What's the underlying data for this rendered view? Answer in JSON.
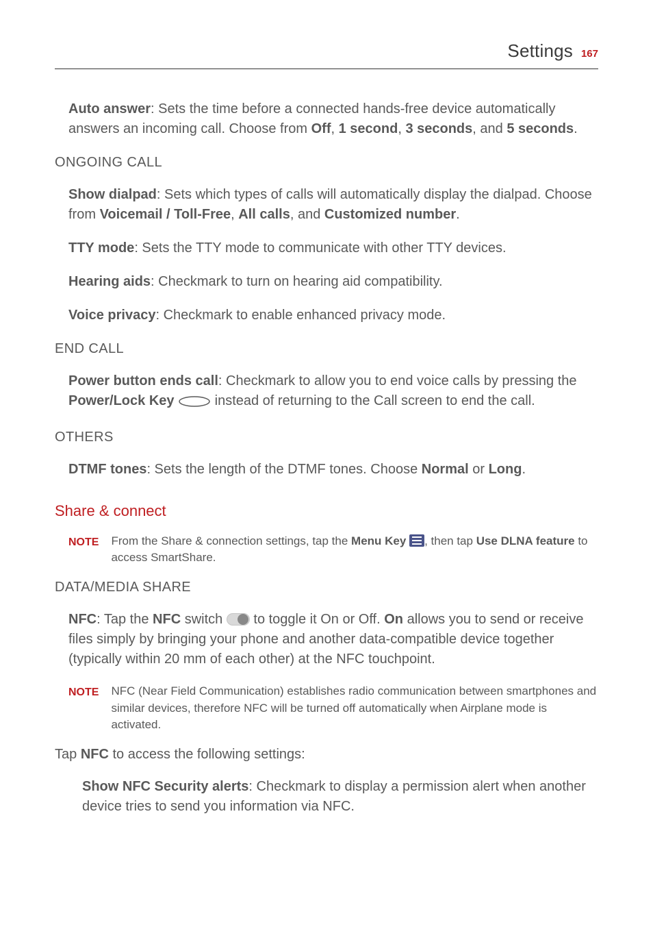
{
  "header": {
    "title": "Settings",
    "page_number": "167"
  },
  "auto_answer": {
    "label": "Auto answer",
    "desc": ": Sets the time before a connected hands-free device automatically answers an incoming call. Choose from ",
    "opts": [
      "Off",
      "1 second",
      "3 seconds",
      "5 seconds"
    ],
    "join1": ", ",
    "join2": ", and ",
    "period": "."
  },
  "ongoing": {
    "heading": "ONGOING CALL",
    "show_dialpad": {
      "label": "Show dialpad",
      "desc": ": Sets which types of calls will automatically display the dialpad. Choose from ",
      "opts": [
        "Voicemail / Toll-Free",
        "All calls",
        "Customized number"
      ],
      "join1": ", ",
      "join2": ", and ",
      "period": "."
    },
    "tty": {
      "label": "TTY mode",
      "desc": ": Sets the TTY mode to communicate with other TTY devices."
    },
    "hearing": {
      "label": "Hearing aids",
      "desc": ": Checkmark to turn on hearing aid compatibility."
    },
    "voice": {
      "label": "Voice privacy",
      "desc": ": Checkmark to enable enhanced privacy mode."
    }
  },
  "endcall": {
    "heading": "END CALL",
    "power": {
      "label": "Power button ends call",
      "desc1": ": Checkmark to allow you to end voice calls by pressing the ",
      "key_label": "Power/Lock Key",
      "desc2": " instead of returning to the Call screen to end the call."
    }
  },
  "others": {
    "heading": "OTHERS",
    "dtmf": {
      "label": "DTMF tones",
      "desc": ": Sets the length of the DTMF tones. Choose ",
      "opts": [
        "Normal",
        "Long"
      ],
      "join": " or ",
      "period": "."
    }
  },
  "share": {
    "heading": "Share & connect",
    "note1": {
      "label": "NOTE",
      "before": "From the Share & connection settings, tap the ",
      "menukey": "Menu Key",
      "mid": ", then tap ",
      "dlna": "Use DLNA feature",
      "after": " to access SmartShare."
    },
    "datamedia_heading": "DATA/MEDIA SHARE",
    "nfc": {
      "label": "NFC",
      "desc1": ": Tap the ",
      "switch_label": "NFC",
      "desc2": " switch ",
      "desc3": " to toggle it On or Off. ",
      "on_label": "On",
      "desc4": " allows you to send or receive files simply by bringing your phone and another data-compatible device together (typically within 20 mm of each other) at the NFC touchpoint."
    },
    "note2": {
      "label": "NOTE",
      "body": "NFC (Near Field Communication) establishes radio communication between smartphones and similar devices, therefore NFC will be turned off automatically when Airplane mode is activated."
    },
    "tap_nfc": {
      "before": "Tap ",
      "nfc": "NFC",
      "after": " to access the following settings:"
    },
    "show_alerts": {
      "label": "Show NFC Security alerts",
      "desc": ": Checkmark to display a permission alert when another device tries to send you information via NFC."
    }
  }
}
